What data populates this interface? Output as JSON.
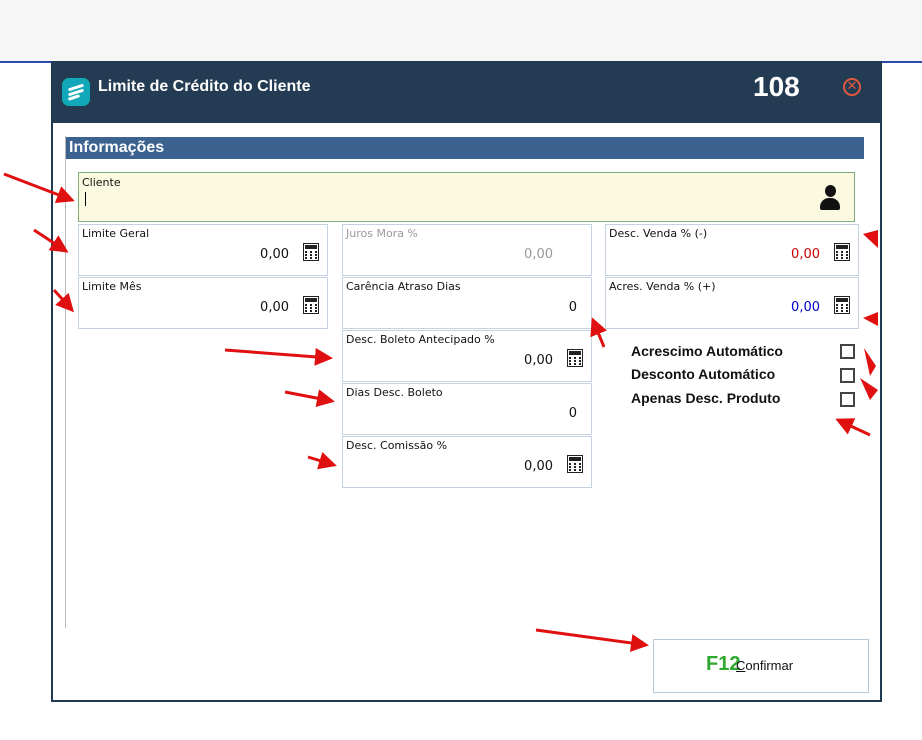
{
  "window": {
    "title": "Limite de Crédito do Cliente",
    "code": "108",
    "close_icon": "close-circle-icon"
  },
  "section": {
    "title": "Informações"
  },
  "cliente": {
    "label": "Cliente",
    "value": "",
    "icon": "person-icon"
  },
  "limite_geral": {
    "label": "Limite Geral",
    "value": "0,00"
  },
  "limite_mes": {
    "label": "Limite Mês",
    "value": "0,00"
  },
  "juros_mora": {
    "label": "Juros Mora %",
    "value": "0,00"
  },
  "carencia": {
    "label": "Carência Atraso Dias",
    "value": "0"
  },
  "desc_boleto_antecipado": {
    "label": "Desc. Boleto Antecipado %",
    "value": "0,00"
  },
  "dias_desc_boleto": {
    "label": "Dias Desc. Boleto",
    "value": "0"
  },
  "desc_comissao": {
    "label": "Desc. Comissão %",
    "value": "0,00"
  },
  "desc_venda": {
    "label": "Desc. Venda % (-)",
    "value": "0,00",
    "color": "#cc0000"
  },
  "acres_venda": {
    "label": "Acres. Venda % (+)",
    "value": "0,00",
    "color": "#0000cc"
  },
  "checkboxes": [
    {
      "label": "Acrescimo Automático",
      "checked": false
    },
    {
      "label": "Desconto Automático",
      "checked": false
    },
    {
      "label": "Apenas Desc. Produto",
      "checked": false
    }
  ],
  "confirm": {
    "key": "F12",
    "label": "Confirmar"
  },
  "colors": {
    "titlebar": "#243c53",
    "section": "#3c6290",
    "arrow": "#e01010"
  }
}
